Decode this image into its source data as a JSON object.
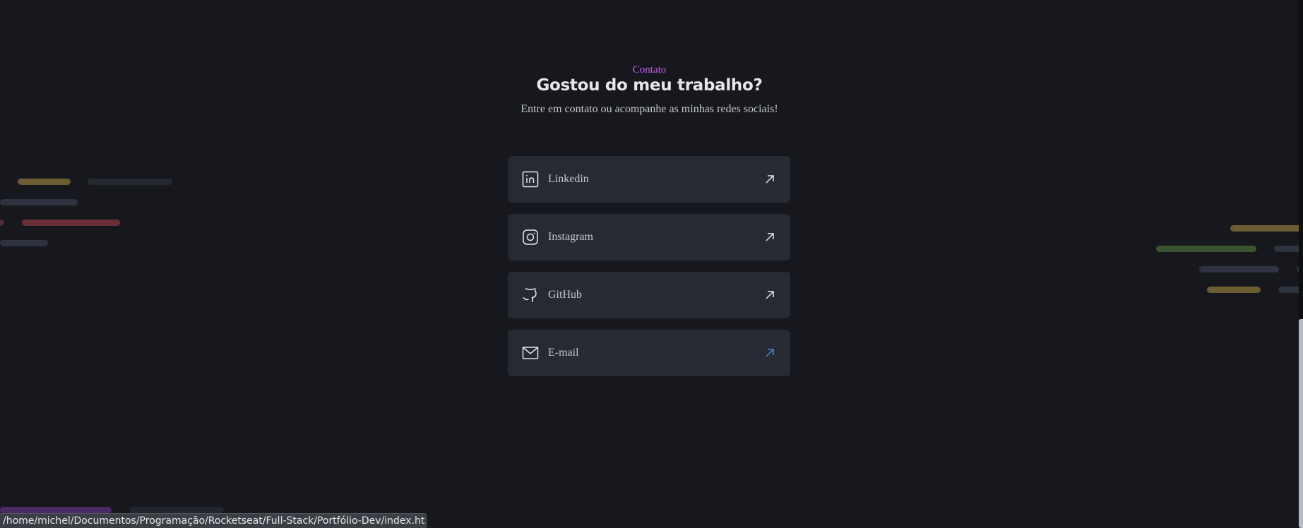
{
  "contact": {
    "eyebrow": "Contato",
    "heading": "Gostou do meu trabalho?",
    "subtitle": "Entre em contato ou acompanhe as minhas redes sociais!"
  },
  "links": [
    {
      "label": "Linkedin",
      "icon": "linkedin-icon",
      "arrow_color": "#e6e7eb"
    },
    {
      "label": "Instagram",
      "icon": "instagram-icon",
      "arrow_color": "#e6e7eb"
    },
    {
      "label": "GitHub",
      "icon": "github-icon",
      "arrow_color": "#e6e7eb"
    },
    {
      "label": "E-mail",
      "icon": "mail-icon",
      "arrow_color": "#3b8fe3"
    }
  ],
  "status_bar": {
    "url": "/home/michel/Documentos/Programação/Rocketseat/Full-Stack/Portfólio-Dev/index.ht..."
  },
  "colors": {
    "background": "#17181d",
    "accent": "#c25cf2",
    "card": "#282a33",
    "link_hover": "#3b8fe3"
  }
}
